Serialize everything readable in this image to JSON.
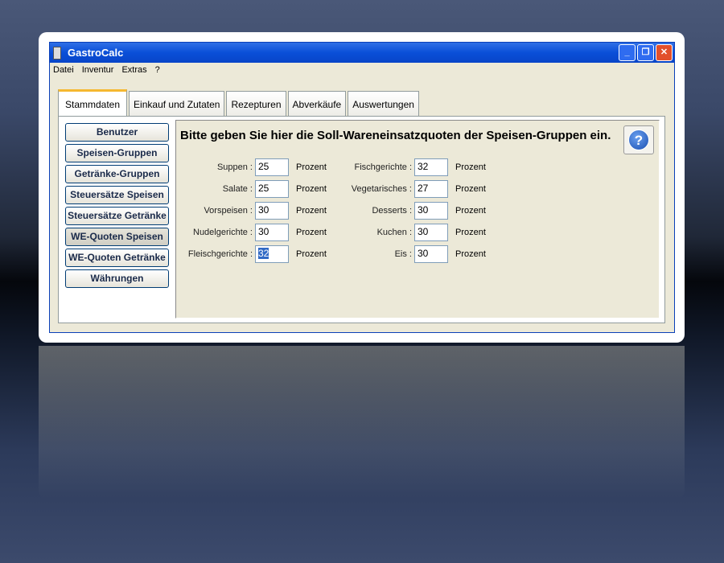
{
  "window": {
    "title": "GastroCalc",
    "minimize": "_",
    "maximize": "❐",
    "close": "✕"
  },
  "menu": [
    "Datei",
    "Inventur",
    "Extras",
    "?"
  ],
  "tabs": [
    "Stammdaten",
    "Einkauf und Zutaten",
    "Rezepturen",
    "Abverkäufe",
    "Auswertungen"
  ],
  "side_buttons": [
    "Benutzer",
    "Speisen-Gruppen",
    "Getränke-Gruppen",
    "Steuersätze Speisen",
    "Steuersätze Getränke",
    "WE-Quoten Speisen",
    "WE-Quoten Getränke",
    "Währungen"
  ],
  "heading": "Bitte geben Sie hier die Soll-Wareneinsatzquoten der Speisen-Gruppen ein.",
  "help": "?",
  "unit": "Prozent",
  "left": [
    {
      "label": "Suppen :",
      "value": "25"
    },
    {
      "label": "Salate :",
      "value": "25"
    },
    {
      "label": "Vorspeisen :",
      "value": "30"
    },
    {
      "label": "Nudelgerichte :",
      "value": "30"
    },
    {
      "label": "Fleischgerichte :",
      "value": "32"
    }
  ],
  "right": [
    {
      "label": "Fischgerichte :",
      "value": "32"
    },
    {
      "label": "Vegetarisches :",
      "value": "27"
    },
    {
      "label": "Desserts :",
      "value": "30"
    },
    {
      "label": "Kuchen :",
      "value": "30"
    },
    {
      "label": "Eis :",
      "value": "30"
    }
  ]
}
